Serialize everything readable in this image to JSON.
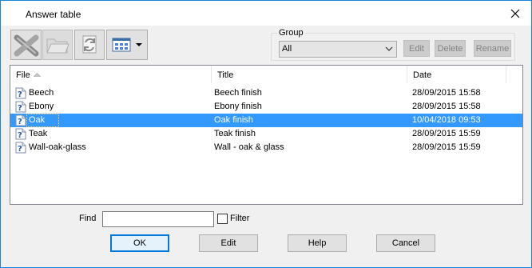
{
  "window": {
    "title": "Answer table"
  },
  "toolbar": {
    "delete_icon": "x-icon",
    "folder_icon": "folder-icon",
    "refresh_icon": "refresh-icon",
    "view_icon": "grid-view-icon"
  },
  "group": {
    "label": "Group",
    "selected": "All",
    "edit_label": "Edit",
    "delete_label": "Delete",
    "rename_label": "Rename"
  },
  "list": {
    "columns": [
      "File",
      "Title",
      "Date"
    ],
    "rows": [
      {
        "file": "Beech",
        "title": "Beech finish",
        "date": "28/09/2015  15:58",
        "selected": false
      },
      {
        "file": "Ebony",
        "title": "Ebony finish",
        "date": "28/09/2015  15:58",
        "selected": false
      },
      {
        "file": "Oak",
        "title": "Oak finish",
        "date": "10/04/2018  09:53",
        "selected": true
      },
      {
        "file": "Teak",
        "title": "Teak finish",
        "date": "28/09/2015  15:59",
        "selected": false
      },
      {
        "file": "Wall-oak-glass",
        "title": "Wall - oak & glass",
        "date": "28/09/2015  15:59",
        "selected": false
      }
    ]
  },
  "find": {
    "label": "Find",
    "value": "",
    "filter_label": "Filter",
    "filter_checked": false
  },
  "buttons": {
    "ok": "OK",
    "edit": "Edit",
    "help": "Help",
    "cancel": "Cancel"
  },
  "colors": {
    "accent": "#0078d7",
    "selection": "#3399ff",
    "border": "#1883d7"
  }
}
